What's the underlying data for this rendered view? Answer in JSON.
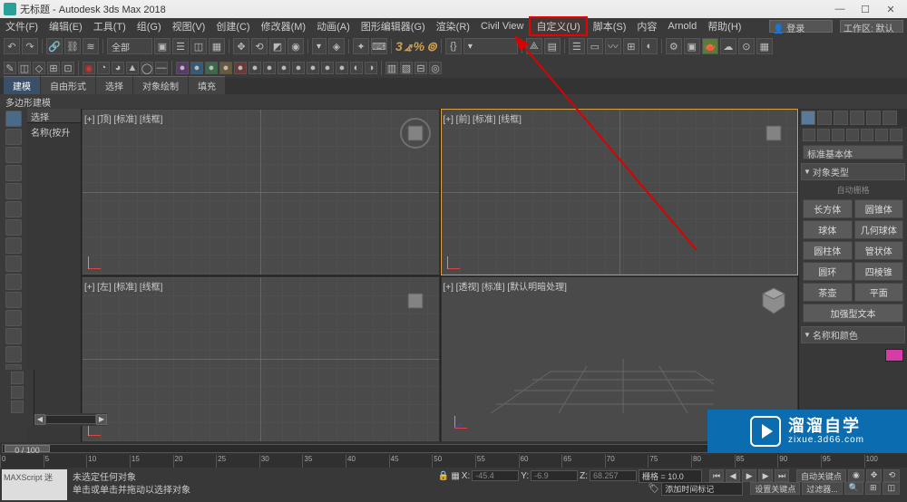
{
  "title": "无标题 - Autodesk 3ds Max 2018",
  "menu": {
    "items": [
      "文件(F)",
      "编辑(E)",
      "工具(T)",
      "组(G)",
      "视图(V)",
      "创建(C)",
      "修改器(M)",
      "动画(A)",
      "图形编辑器(G)",
      "渲染(R)",
      "Civil View",
      "自定义(U)",
      "脚本(S)",
      "内容",
      "Arnold",
      "帮助(H)"
    ],
    "highlight_index": 11,
    "search_placeholder": "登录",
    "workspace_label": "工作区: 默认"
  },
  "toolbar": {
    "dropdown_all": "全部",
    "curve_dropdown": ""
  },
  "ribbon": {
    "tabs": [
      "建模",
      "自由形式",
      "选择",
      "对象绘制",
      "填充"
    ],
    "subpanel": "多边形建模"
  },
  "scene_explorer": {
    "header": "选择",
    "sort": "名称(按升"
  },
  "viewports": {
    "top": "[+] [顶] [标准] [线框]",
    "front": "[+] [前] [标准] [线框]",
    "left": "[+] [左] [标准] [线框]",
    "persp": "[+] [透视] [标准] [默认明暗处理]"
  },
  "command_panel": {
    "category": "标准基本体",
    "rollout_objtype": "对象类型",
    "autogrid": "自动栅格",
    "objects": [
      "长方体",
      "圆锥体",
      "球体",
      "几何球体",
      "圆柱体",
      "管状体",
      "圆环",
      "四棱锥",
      "茶壶",
      "平面",
      "加强型文本",
      ""
    ],
    "rollout_name": "名称和颜色",
    "color": "#d63ca8"
  },
  "timeline": {
    "thumb": "0 / 100",
    "start": 0,
    "end": 100,
    "marks": [
      0,
      5,
      10,
      15,
      20,
      25,
      30,
      35,
      40,
      45,
      50,
      55,
      60,
      65,
      70,
      75,
      80,
      85,
      90,
      95,
      100
    ]
  },
  "status": {
    "line1": "未选定任何对象",
    "line2": "单击或单击并拖动以选择对象",
    "x_label": "X:",
    "y_label": "Y:",
    "z_label": "Z:",
    "x": "-45.4",
    "y": "-6.9",
    "z": "68.257",
    "grid_label": "栅格 = 10.0",
    "add_time_tag": "添加时间标记",
    "autokey": "自动关键点",
    "setkey": "设置关键点",
    "filter": "过滤器...",
    "maxscript": "MAXScript 迷"
  },
  "watermark": {
    "big": "溜溜自学",
    "small": "zixue.3d66.com"
  }
}
